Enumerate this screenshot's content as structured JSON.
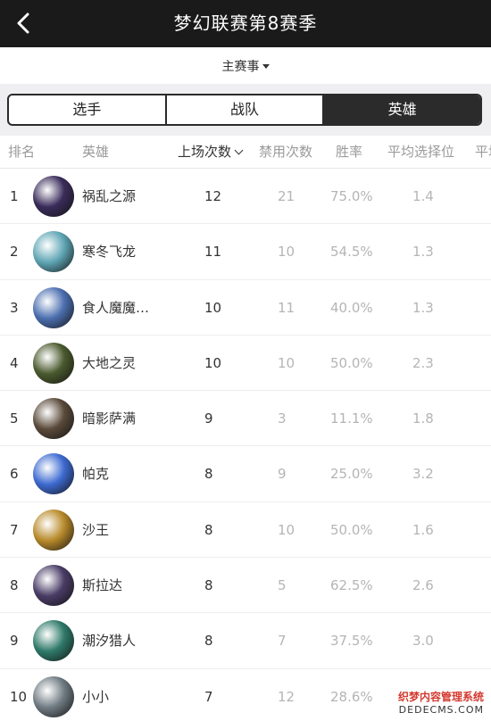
{
  "header": {
    "title": "梦幻联赛第8赛季",
    "back_icon": "chevron-left-icon"
  },
  "filter": {
    "label": "主赛事"
  },
  "tabs": [
    {
      "label": "选手",
      "active": false
    },
    {
      "label": "战队",
      "active": false
    },
    {
      "label": "英雄",
      "active": true
    }
  ],
  "columns": {
    "rank": "排名",
    "hero": "英雄",
    "picks": "上场次数",
    "bans": "禁用次数",
    "winrate": "胜率",
    "avg_pick_pos": "平均选择位",
    "overflow": "平均"
  },
  "rows": [
    {
      "rank": "1",
      "name": "祸乱之源",
      "picks": "12",
      "bans": "21",
      "winrate": "75.0%",
      "avg_pos": "1.4",
      "avatar_color": "#3a2c5a"
    },
    {
      "rank": "2",
      "name": "寒冬飞龙",
      "picks": "11",
      "bans": "10",
      "winrate": "54.5%",
      "avg_pos": "1.3",
      "avatar_color": "#5fa6b5"
    },
    {
      "rank": "3",
      "name": "食人魔魔…",
      "picks": "10",
      "bans": "11",
      "winrate": "40.0%",
      "avg_pos": "1.3",
      "avatar_color": "#4c6fb0"
    },
    {
      "rank": "4",
      "name": "大地之灵",
      "picks": "10",
      "bans": "10",
      "winrate": "50.0%",
      "avg_pos": "2.3",
      "avatar_color": "#4b5a2e"
    },
    {
      "rank": "5",
      "name": "暗影萨满",
      "picks": "9",
      "bans": "3",
      "winrate": "11.1%",
      "avg_pos": "1.8",
      "avatar_color": "#5a4a3a"
    },
    {
      "rank": "6",
      "name": "帕克",
      "picks": "8",
      "bans": "9",
      "winrate": "25.0%",
      "avg_pos": "3.2",
      "avatar_color": "#3d6ad1"
    },
    {
      "rank": "7",
      "name": "沙王",
      "picks": "8",
      "bans": "10",
      "winrate": "50.0%",
      "avg_pos": "1.6",
      "avatar_color": "#b88a2a"
    },
    {
      "rank": "8",
      "name": "斯拉达",
      "picks": "8",
      "bans": "5",
      "winrate": "62.5%",
      "avg_pos": "2.6",
      "avatar_color": "#4a3c66"
    },
    {
      "rank": "9",
      "name": "潮汐猎人",
      "picks": "8",
      "bans": "7",
      "winrate": "37.5%",
      "avg_pos": "3.0",
      "avatar_color": "#2f7a6a"
    },
    {
      "rank": "10",
      "name": "小小",
      "picks": "7",
      "bans": "12",
      "winrate": "28.6%",
      "avg_pos": "",
      "avatar_color": "#6f7b82"
    }
  ],
  "watermark": {
    "line1": "织梦内容管理系统",
    "line2": "DEDECMS.COM"
  }
}
